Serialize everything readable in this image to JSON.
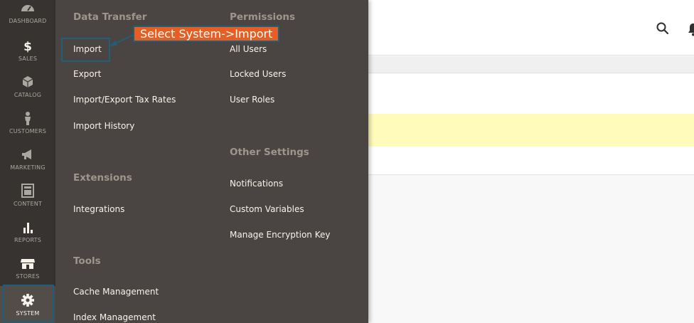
{
  "sidebar": {
    "items": [
      {
        "label": "DASHBOARD",
        "icon": "dashboard-icon"
      },
      {
        "label": "SALES",
        "icon": "dollar-icon"
      },
      {
        "label": "CATALOG",
        "icon": "cube-icon"
      },
      {
        "label": "CUSTOMERS",
        "icon": "person-icon"
      },
      {
        "label": "MARKETING",
        "icon": "megaphone-icon"
      },
      {
        "label": "CONTENT",
        "icon": "layout-icon"
      },
      {
        "label": "REPORTS",
        "icon": "bar-chart-icon"
      },
      {
        "label": "STORES",
        "icon": "storefront-icon"
      },
      {
        "label": "SYSTEM",
        "icon": "gear-icon"
      }
    ],
    "active": "SYSTEM"
  },
  "flyout": {
    "col1": {
      "data_transfer": {
        "title": "Data Transfer",
        "links": [
          "Import",
          "Export",
          "Import/Export Tax Rates",
          "Import History"
        ]
      },
      "extensions": {
        "title": "Extensions",
        "links": [
          "Integrations"
        ]
      },
      "tools": {
        "title": "Tools",
        "links": [
          "Cache Management",
          "Index Management"
        ]
      }
    },
    "col2": {
      "permissions": {
        "title": "Permissions",
        "links": [
          "All Users",
          "Locked Users",
          "User Roles"
        ]
      },
      "other_settings": {
        "title": "Other Settings",
        "links": [
          "Notifications",
          "Custom Variables",
          "Manage Encryption Key"
        ]
      }
    }
  },
  "callout": {
    "text": "Select System->Import"
  },
  "header": {
    "search_icon": "search-icon",
    "bell_icon": "bell-icon"
  },
  "colors": {
    "sidebar_bg": "#373330",
    "flyout_bg": "#4a4542",
    "callout_bg": "#e85d22",
    "highlight_border": "#1f5f7a",
    "notice_bg": "#fffbbb"
  }
}
